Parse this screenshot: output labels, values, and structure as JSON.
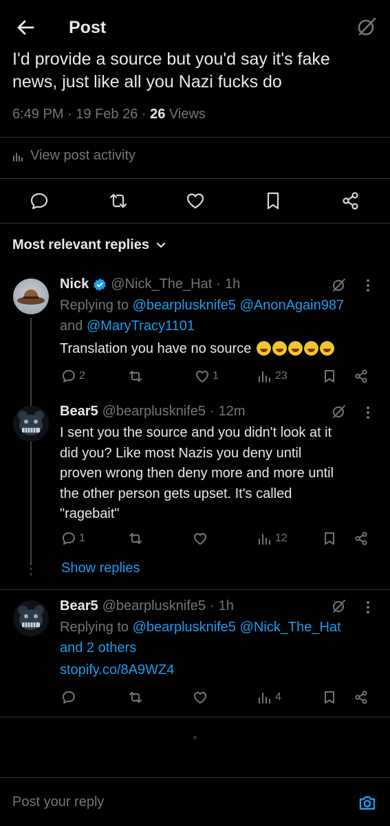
{
  "header": {
    "title": "Post",
    "back_icon": "arrow-left-icon",
    "grok_icon": "grok-icon"
  },
  "post": {
    "text_line1": "I'd provide a source but you'd say it's fake",
    "text_line2": "news, just like all you Nazi fucks do",
    "time": "6:49 PM",
    "date": "19 Feb 26",
    "views_count": "26",
    "views_label": "Views",
    "activity_label": "View post activity"
  },
  "sort_label": "Most relevant replies",
  "replies": [
    {
      "name": "Nick",
      "verified": true,
      "handle": "@Nick_The_Hat",
      "time": "1h",
      "replying_label": "Replying to",
      "replying_to_1": "@bearplusknife5",
      "replying_to_2": "@AnonAgain987",
      "replying_and": "and",
      "replying_to_3": "@MaryTracy1101",
      "text": "Translation you have no source",
      "emojis": [
        "🤣",
        "😂",
        "🤣",
        "🤣",
        "😂"
      ],
      "replies": "2",
      "reposts": "",
      "likes": "1",
      "views": "23"
    },
    {
      "name": "Bear5",
      "handle": "@bearplusknife5",
      "time": "12m",
      "text_lines": [
        "I sent you the source and you didn't look at it",
        "did you? Like most Nazis you deny until",
        "proven wrong then deny more and more until",
        "the other person gets upset. It's called",
        "\"ragebait\""
      ],
      "replies": "1",
      "likes": "",
      "views": "12",
      "show_replies_label": "Show replies"
    },
    {
      "name": "Bear5",
      "handle": "@bearplusknife5",
      "time": "1h",
      "replying_label": "Replying to",
      "replying_to_1": "@bearplusknife5",
      "replying_to_2": "@Nick_The_Hat",
      "replying_and_others": "and 2 others",
      "link": "stopify.co/8A9WZ4",
      "views": "4"
    }
  ],
  "composer": {
    "placeholder": "Post your reply",
    "camera_icon": "camera-icon"
  },
  "colors": {
    "background": "#000000",
    "text": "#e7e9ea",
    "muted": "#71767b",
    "accent": "#1d9bf0",
    "divider": "#2f3336"
  }
}
